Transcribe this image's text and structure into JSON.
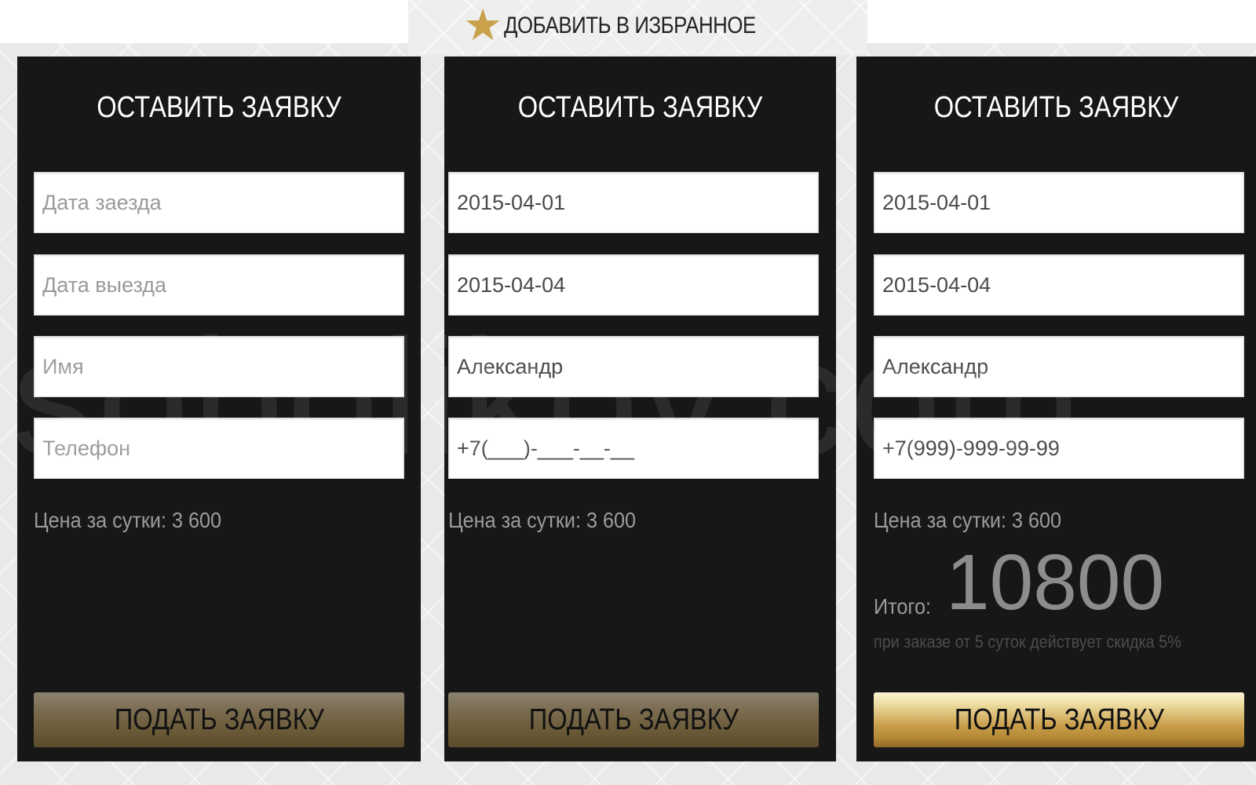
{
  "header": {
    "favorite_label": "ДОБАВИТЬ В ИЗБРАННОЕ",
    "favorite_icon": "star-icon"
  },
  "watermark": "sobolikov.com",
  "forms": [
    {
      "title": "ОСТАВИТЬ ЗАЯВКУ",
      "checkin": {
        "value": "",
        "placeholder": "Дата заезда"
      },
      "checkout": {
        "value": "",
        "placeholder": "Дата выезда"
      },
      "name": {
        "value": "",
        "placeholder": "Имя"
      },
      "phone": {
        "value": "",
        "placeholder": "Телефон"
      },
      "price": "Цена за сутки: 3 600",
      "submit_label": "ПОДАТЬ ЗАЯВКУ"
    },
    {
      "title": "ОСТАВИТЬ ЗАЯВКУ",
      "checkin": {
        "value": "2015-04-01",
        "placeholder": "Дата заезда"
      },
      "checkout": {
        "value": "2015-04-04",
        "placeholder": "Дата выезда"
      },
      "name": {
        "value": "Александр",
        "placeholder": "Имя"
      },
      "phone": {
        "value": "+7(___)-___-__-__",
        "placeholder": "Телефон"
      },
      "price": "Цена за сутки: 3 600",
      "submit_label": "ПОДАТЬ ЗАЯВКУ"
    },
    {
      "title": "ОСТАВИТЬ ЗАЯВКУ",
      "checkin": {
        "value": "2015-04-01",
        "placeholder": "Дата заезда"
      },
      "checkout": {
        "value": "2015-04-04",
        "placeholder": "Дата выезда"
      },
      "name": {
        "value": "Александр",
        "placeholder": "Имя"
      },
      "phone": {
        "value": "+7(999)-999-99-99",
        "placeholder": "Телефон"
      },
      "price": "Цена за сутки: 3 600",
      "total_label": "Итого:",
      "total_value": "10800",
      "discount_note": "при заказе от 5 суток действует скидка 5%",
      "submit_label": "ПОДАТЬ ЗАЯВКУ"
    }
  ],
  "colors": {
    "panel": "#171717",
    "gold": "#c9a14a",
    "price_text": "#9c9c9c"
  }
}
